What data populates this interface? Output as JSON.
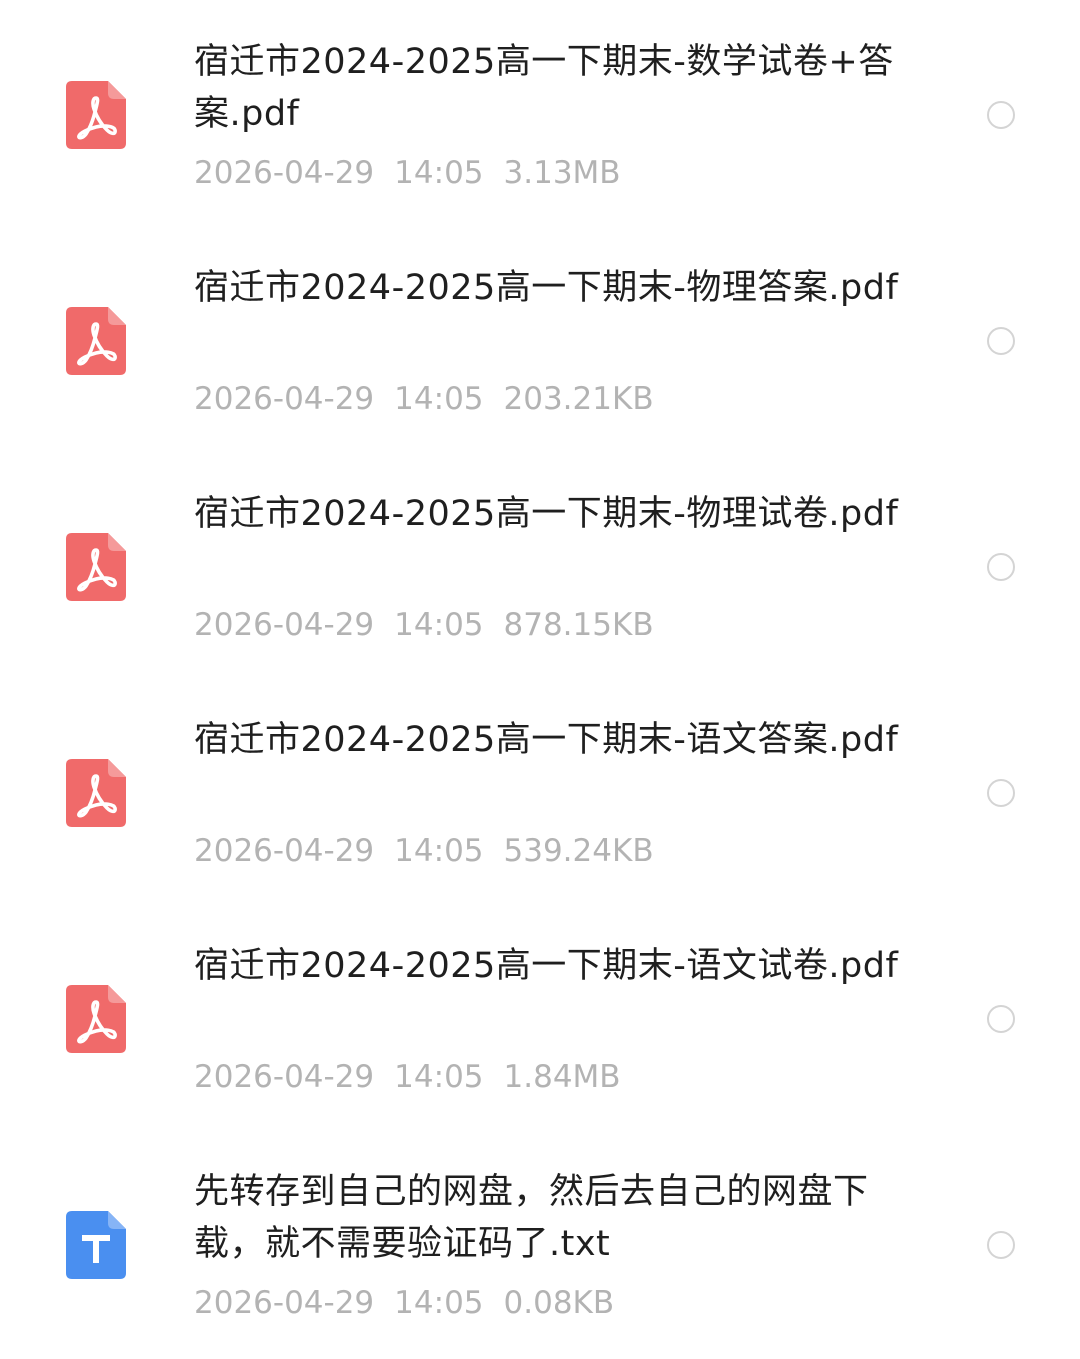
{
  "files": [
    {
      "name": "宿迁市2024-2025高一下期末-数学试卷+答案.pdf",
      "date": "2026-04-29",
      "time": "14:05",
      "size": "3.13MB",
      "type": "pdf"
    },
    {
      "name": "宿迁市2024-2025高一下期末-物理答案.pdf",
      "date": "2026-04-29",
      "time": "14:05",
      "size": "203.21KB",
      "type": "pdf"
    },
    {
      "name": "宿迁市2024-2025高一下期末-物理试卷.pdf",
      "date": "2026-04-29",
      "time": "14:05",
      "size": "878.15KB",
      "type": "pdf"
    },
    {
      "name": "宿迁市2024-2025高一下期末-语文答案.pdf",
      "date": "2026-04-29",
      "time": "14:05",
      "size": "539.24KB",
      "type": "pdf"
    },
    {
      "name": "宿迁市2024-2025高一下期末-语文试卷.pdf",
      "date": "2026-04-29",
      "time": "14:05",
      "size": "1.84MB",
      "type": "pdf"
    },
    {
      "name": "先转存到自己的网盘，然后去自己的网盘下载，就不需要验证码了.txt",
      "date": "2026-04-29",
      "time": "14:05",
      "size": "0.08KB",
      "type": "txt"
    }
  ],
  "icons": {
    "pdf": "pdf-file-icon",
    "txt": "txt-file-icon"
  },
  "colors": {
    "pdf_icon": "#f06a6a",
    "txt_icon": "#4a8ff0",
    "name_text": "#1f1f1f",
    "meta_text": "#b3b3b3"
  }
}
